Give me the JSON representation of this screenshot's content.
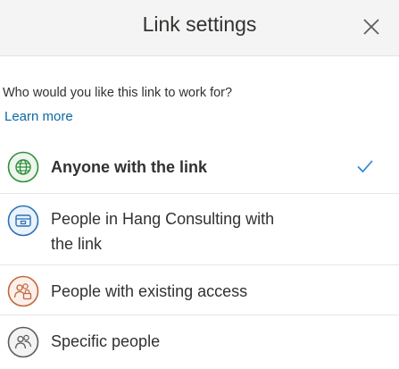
{
  "header": {
    "title": "Link settings",
    "close_icon": "close-icon"
  },
  "prompt": {
    "question": "Who would you like this link to work for?",
    "learn_more": "Learn more"
  },
  "options": [
    {
      "label": "Anyone with the link",
      "icon": "globe-icon",
      "selected": true,
      "color": "#2f8f3a"
    },
    {
      "label_line1": "People in Hang Consulting with",
      "label_line2": "the link",
      "icon": "building-icon",
      "selected": false,
      "color": "#2b6fb5"
    },
    {
      "label": "People with existing access",
      "icon": "people-lock-icon",
      "selected": false,
      "color": "#c2663a"
    },
    {
      "label": "Specific people",
      "icon": "people-icon",
      "selected": false,
      "color": "#5c5c5c"
    }
  ],
  "colors": {
    "accent": "#0b6aa2",
    "check": "#2b88d8"
  }
}
